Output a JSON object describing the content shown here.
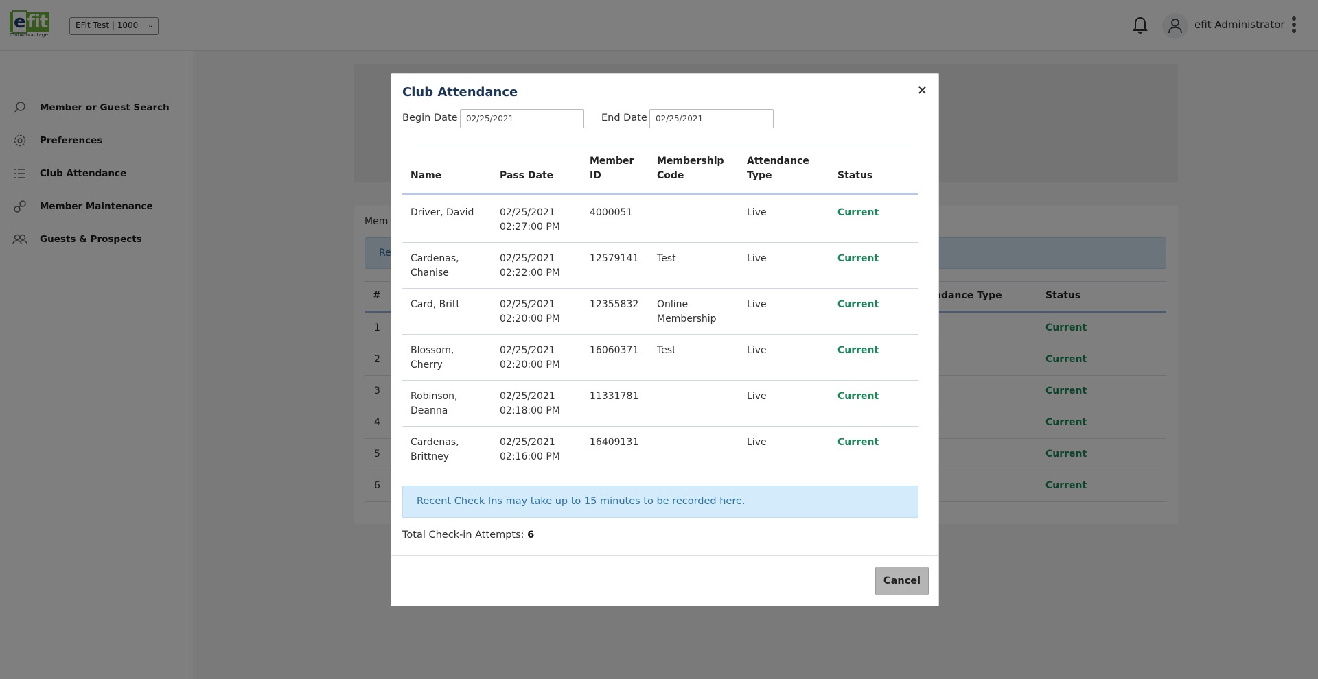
{
  "header": {
    "logo_text": "efit",
    "logo_sub": "ClubAdvantage",
    "club_select_value": "EFit Test | 1000",
    "username": "efit Administrator"
  },
  "sidebar": {
    "items": [
      {
        "label": "Member or Guest Search",
        "icon": "search-icon"
      },
      {
        "label": "Preferences",
        "icon": "gear-icon"
      },
      {
        "label": "Club Attendance",
        "icon": "list-icon"
      },
      {
        "label": "Member Maintenance",
        "icon": "link-icon"
      },
      {
        "label": "Guests & Prospects",
        "icon": "people-icon"
      }
    ]
  },
  "background": {
    "members_label": "Mem",
    "alert_fragment": "Re",
    "col_hash": "#",
    "col_attendance_fragment": "ndance Type",
    "col_status": "Status",
    "rows": [
      {
        "num": "1",
        "status": "Current"
      },
      {
        "num": "2",
        "status": "Current"
      },
      {
        "num": "3",
        "status": "Current"
      },
      {
        "num": "4",
        "status": "Current"
      },
      {
        "num": "5",
        "status": "Current"
      },
      {
        "num": "6",
        "status": "Current"
      }
    ]
  },
  "modal": {
    "title": "Club Attendance",
    "close": "×",
    "begin_date_label": "Begin Date",
    "begin_date_value": "02/25/2021",
    "end_date_label": "End Date",
    "end_date_value": "02/25/2021",
    "columns": {
      "name": "Name",
      "pass_date": "Pass Date",
      "member_id_1": "Member",
      "member_id_2": "ID",
      "membership_code_1": "Membership",
      "membership_code_2": "Code",
      "attendance_type_1": "Attendance",
      "attendance_type_2": "Type",
      "status": "Status"
    },
    "rows": [
      {
        "name1": "Driver, David",
        "name2": "",
        "date1": "02/25/2021",
        "date2": "02:27:00 PM",
        "member_id": "4000051",
        "code1": "",
        "code2": "",
        "type": "Live",
        "status": "Current"
      },
      {
        "name1": "Cardenas,",
        "name2": "Chanise",
        "date1": "02/25/2021",
        "date2": "02:22:00 PM",
        "member_id": "12579141",
        "code1": "Test",
        "code2": "",
        "type": "Live",
        "status": "Current"
      },
      {
        "name1": "Card, Britt",
        "name2": "",
        "date1": "02/25/2021",
        "date2": "02:20:00 PM",
        "member_id": "12355832",
        "code1": "Online",
        "code2": "Membership",
        "type": "Live",
        "status": "Current"
      },
      {
        "name1": "Blossom,",
        "name2": "Cherry",
        "date1": "02/25/2021",
        "date2": "02:20:00 PM",
        "member_id": "16060371",
        "code1": "Test",
        "code2": "",
        "type": "Live",
        "status": "Current"
      },
      {
        "name1": "Robinson,",
        "name2": "Deanna",
        "date1": "02/25/2021",
        "date2": "02:18:00 PM",
        "member_id": "11331781",
        "code1": "",
        "code2": "",
        "type": "Live",
        "status": "Current"
      },
      {
        "name1": "Cardenas,",
        "name2": "Brittney",
        "date1": "02/25/2021",
        "date2": "02:16:00 PM",
        "member_id": "16409131",
        "code1": "",
        "code2": "",
        "type": "Live",
        "status": "Current"
      }
    ],
    "alert": "Recent Check Ins may take up to 15 minutes to be recorded here.",
    "total_label": "Total Check-in Attempts: ",
    "total_value": "6",
    "cancel_label": "Cancel"
  },
  "colors": {
    "accent_green": "#6bb33b",
    "status_green": "#1a8a5a",
    "title_navy": "#1c3557",
    "alert_bg": "#d4ebfb"
  }
}
